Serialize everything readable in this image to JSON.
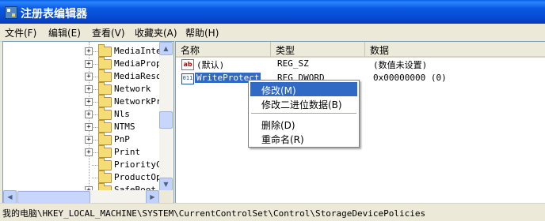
{
  "window": {
    "title": "注册表编辑器"
  },
  "menu": [
    "文件(F)",
    "编辑(E)",
    "查看(V)",
    "收藏夹(A)",
    "帮助(H)"
  ],
  "tree": {
    "items": [
      {
        "label": "MediaInter",
        "expandable": true
      },
      {
        "label": "MediaPrope",
        "expandable": true
      },
      {
        "label": "MediaResou",
        "expandable": true
      },
      {
        "label": "Network",
        "expandable": true
      },
      {
        "label": "NetworkPro",
        "expandable": true
      },
      {
        "label": "Nls",
        "expandable": true
      },
      {
        "label": "NTMS",
        "expandable": true
      },
      {
        "label": "PnP",
        "expandable": true
      },
      {
        "label": "Print",
        "expandable": true
      },
      {
        "label": "PriorityCo",
        "expandable": false
      },
      {
        "label": "ProductOpt",
        "expandable": false
      },
      {
        "label": "SafeBoot",
        "expandable": true
      }
    ],
    "expander_symbol": "+"
  },
  "list": {
    "columns": [
      "名称",
      "类型",
      "数据"
    ],
    "rows": [
      {
        "icon": "string-value-icon",
        "icon_text": "ab",
        "name": "(默认)",
        "type": "REG_SZ",
        "data": "(数值未设置)"
      },
      {
        "icon": "binary-value-icon",
        "icon_text": "011",
        "name": "WriteProtect",
        "type": "REG_DWORD",
        "data": "0x00000000 (0)"
      }
    ]
  },
  "context_menu": {
    "items": [
      "修改(M)",
      "修改二进位数据(B)",
      "删除(D)",
      "重命名(R)"
    ],
    "active_index": 0
  },
  "status": {
    "path": "我的电脑\\HKEY_LOCAL_MACHINE\\SYSTEM\\CurrentControlSet\\Control\\StorageDevicePolicies"
  },
  "colors": {
    "titlebar": "#0a5fe6",
    "selection": "#316ac5",
    "chrome": "#ece9d8"
  }
}
